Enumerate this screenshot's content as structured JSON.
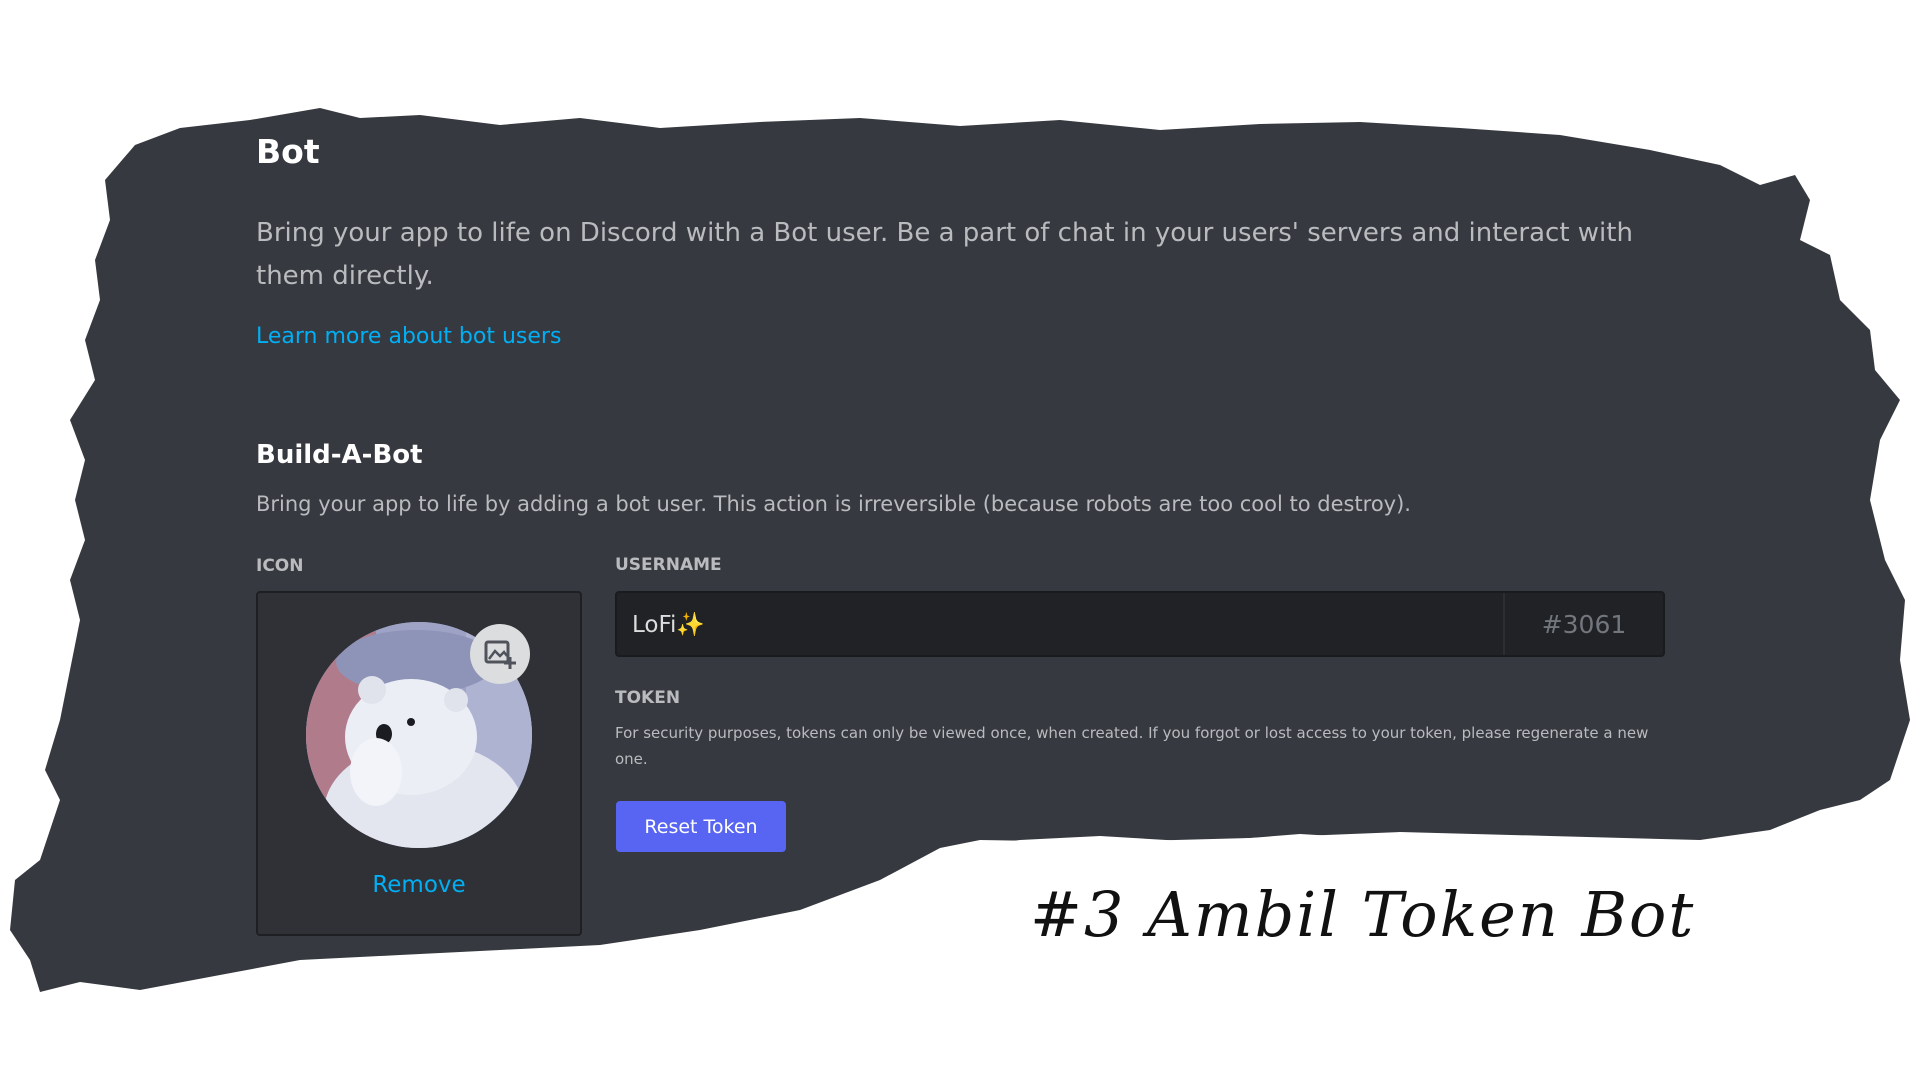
{
  "section": {
    "title": "Bot",
    "description": "Bring your app to life on Discord with a Bot user. Be a part of chat in your users' servers and interact with them directly.",
    "learn_more_link": "Learn more about bot users"
  },
  "build_a_bot": {
    "title": "Build-A-Bot",
    "subtitle": "Bring your app to life by adding a bot user. This action is irreversible (because robots are too cool to destroy).",
    "icon_label": "ICON",
    "remove_label": "Remove",
    "upload_icon": "image-plus-icon",
    "avatar_icon": "polar-bear-avatar-icon",
    "username_label": "USERNAME",
    "username_value": "LoFi✨",
    "discriminator": "#3061",
    "token_label": "TOKEN",
    "token_description": "For security purposes, tokens can only be viewed once, when created. If you forgot or lost access to your token, please regenerate a new one.",
    "reset_token_label": "Reset Token"
  },
  "overlay_caption": "#3 Ambil Token Bot",
  "colors": {
    "background_dark": "#36393f",
    "link": "#00aff4",
    "blurple_button": "#5865f2",
    "text_primary": "#ffffff",
    "text_muted": "#b9bbbe"
  }
}
